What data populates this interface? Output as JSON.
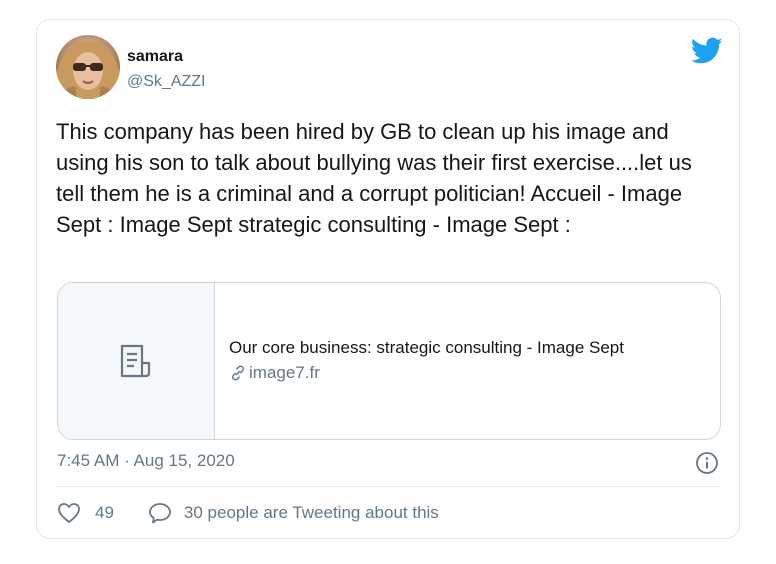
{
  "tweet": {
    "author": {
      "name": "samara",
      "handle": "@Sk_AZZI"
    },
    "text": "This company has been hired by GB to clean up his image and using his son to talk about bullying was their first exercise....let us tell them he is a criminal and a corrupt politician! Accueil - Image Sept : Image Sept strategic consulting - Image Sept :",
    "link_card": {
      "title": "Our core business: strategic consulting - Image Sept",
      "domain": "image7.fr",
      "thumbnail_icon": "document-icon",
      "link_icon": "link-icon"
    },
    "timestamp": "7:45 AM · Aug 15, 2020",
    "stats": {
      "likes": "49",
      "replies_text": "30 people are Tweeting about this"
    }
  },
  "colors": {
    "brand": "#1da1f2",
    "text_primary": "#14171a",
    "text_secondary": "#657786",
    "border": "#e1e8ed"
  },
  "icons": {
    "logo": "twitter-bird-icon",
    "info": "info-icon",
    "like": "heart-icon",
    "reply": "speech-bubble-icon"
  }
}
